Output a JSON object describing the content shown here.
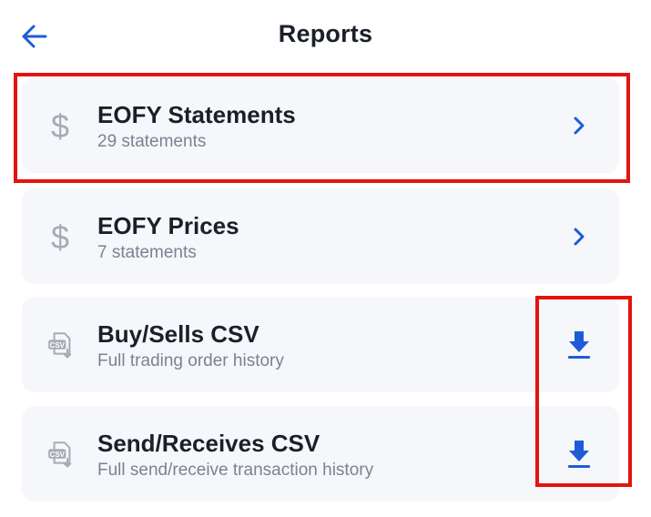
{
  "header": {
    "title": "Reports",
    "back_icon": "arrow-left-icon"
  },
  "colors": {
    "accent": "#1f5bd8",
    "muted_icon": "#a7abb5",
    "card_bg": "#f6f7fa",
    "highlight": "#e3140f"
  },
  "items": [
    {
      "label": "EOFY Statements",
      "sub": "29 statements",
      "icon": "dollar-icon",
      "action_icon": "chevron-right-icon"
    },
    {
      "label": "EOFY Prices",
      "sub": "7 statements",
      "icon": "dollar-icon",
      "action_icon": "chevron-right-icon"
    },
    {
      "label": "Buy/Sells CSV",
      "sub": "Full trading order history",
      "icon": "csv-file-icon",
      "icon_text": "CSV",
      "action_icon": "download-icon"
    },
    {
      "label": "Send/Receives CSV",
      "sub": "Full send/receive transaction history",
      "icon": "csv-file-icon",
      "icon_text": "CSV",
      "action_icon": "download-icon"
    }
  ]
}
